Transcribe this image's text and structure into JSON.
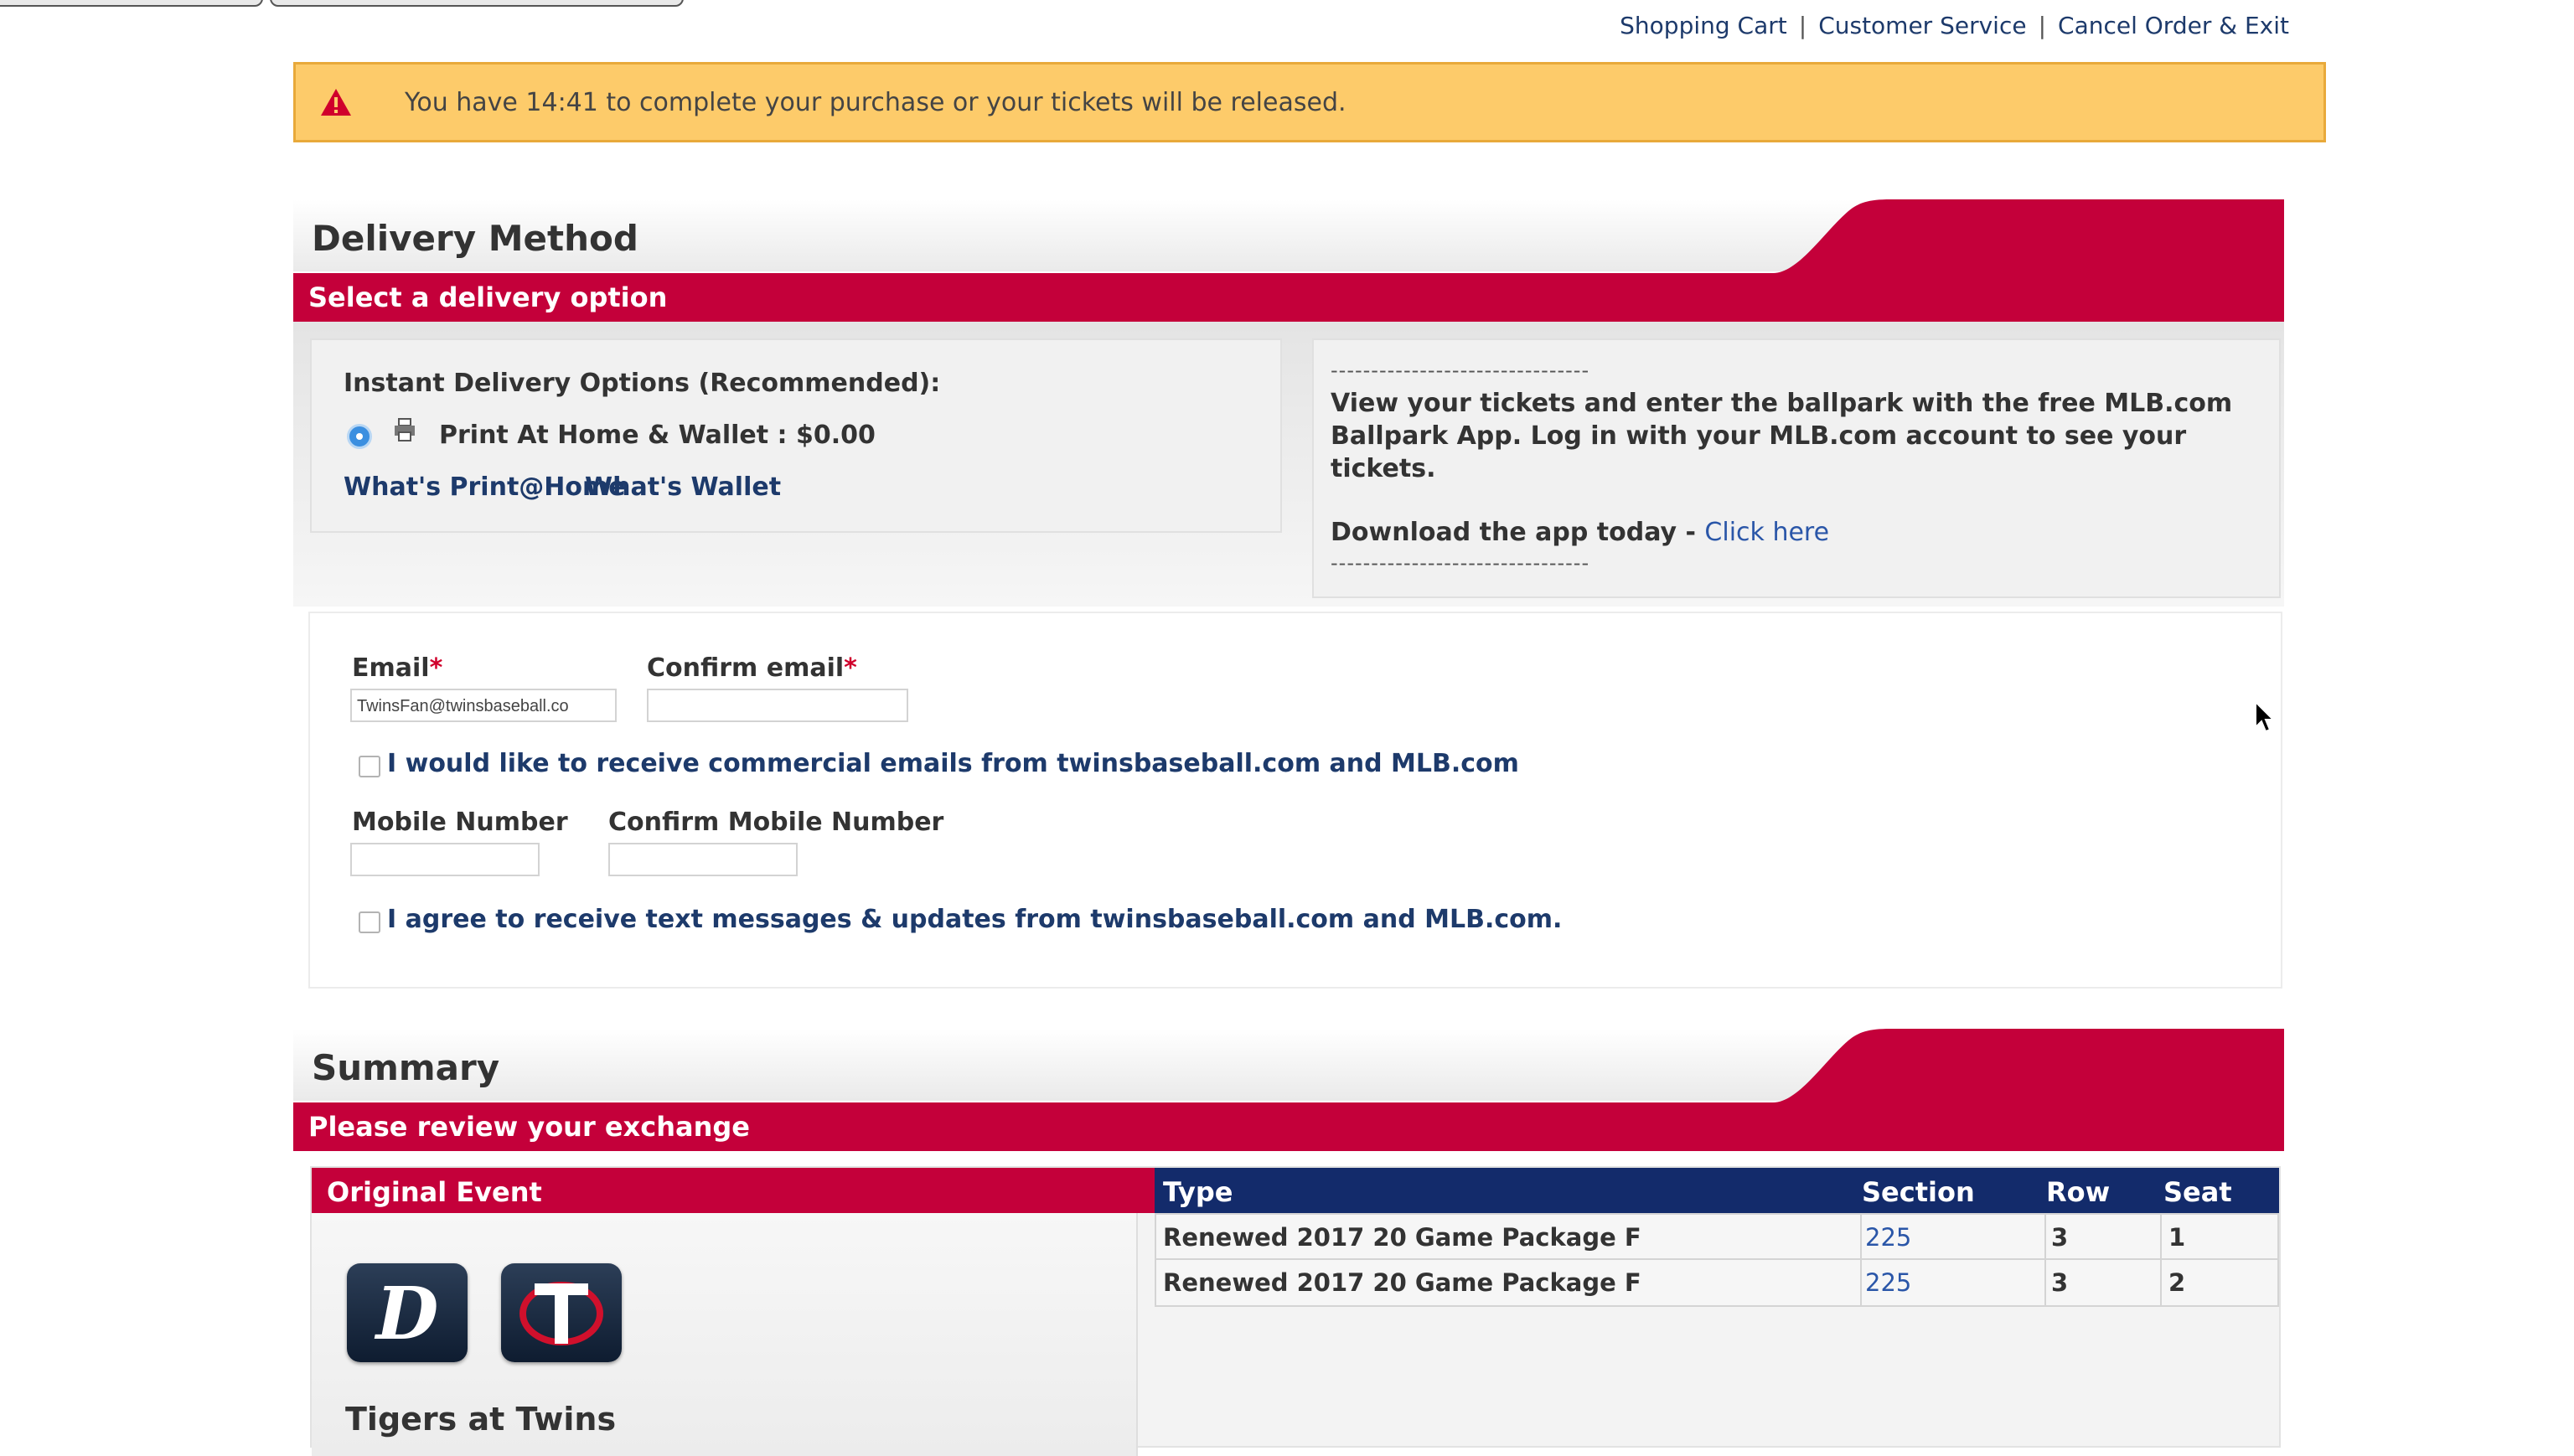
{
  "top_links": [
    "Shopping Cart",
    "Customer Service",
    "Cancel Order & Exit"
  ],
  "timer": {
    "message": "You have 14:41 to complete your purchase or your tickets will be released."
  },
  "delivery": {
    "title": "Delivery Method",
    "subtitle": "Select a delivery option",
    "instant_heading": "Instant Delivery Options (Recommended):",
    "option_label": "Print At Home & Wallet : $0.00",
    "whats_printhome": "What's Print@Home",
    "whats_wallet": "What's Wallet",
    "app_dashes": "--------------------------------",
    "app_text": "View your tickets and enter the ballpark with the free MLB.com Ballpark App. Log in with your MLB.com account to see your tickets.",
    "download_text": "Download the app today - ",
    "click_here": "Click here"
  },
  "contact": {
    "email_label": "Email",
    "email_value": "TwinsFan@twinsbaseball.co",
    "confirm_email_label": "Confirm email",
    "commercial_emails": "I would like to receive commercial emails from twinsbaseball.com and MLB.com",
    "mobile_label": "Mobile Number",
    "confirm_mobile_label": "Confirm Mobile Number",
    "text_messages": "I agree to receive text messages & updates from twinsbaseball.com and MLB.com.",
    "required_mark": "*"
  },
  "summary": {
    "title": "Summary",
    "subtitle": "Please review your exchange",
    "original_event": "Original Event",
    "event_name": "Tigers at Twins",
    "columns": [
      "Type",
      "Section",
      "Row",
      "Seat"
    ],
    "rows": [
      {
        "type": "Renewed 2017 20 Game Package F",
        "section": "225",
        "row": "3",
        "seat": "1"
      },
      {
        "type": "Renewed 2017 20 Game Package F",
        "section": "225",
        "row": "3",
        "seat": "2"
      }
    ]
  },
  "colors": {
    "mlb_red": "#c4003a",
    "navy": "#132b6b",
    "timer_bg": "#fdcb6a",
    "link_blue": "#2a56a8"
  }
}
